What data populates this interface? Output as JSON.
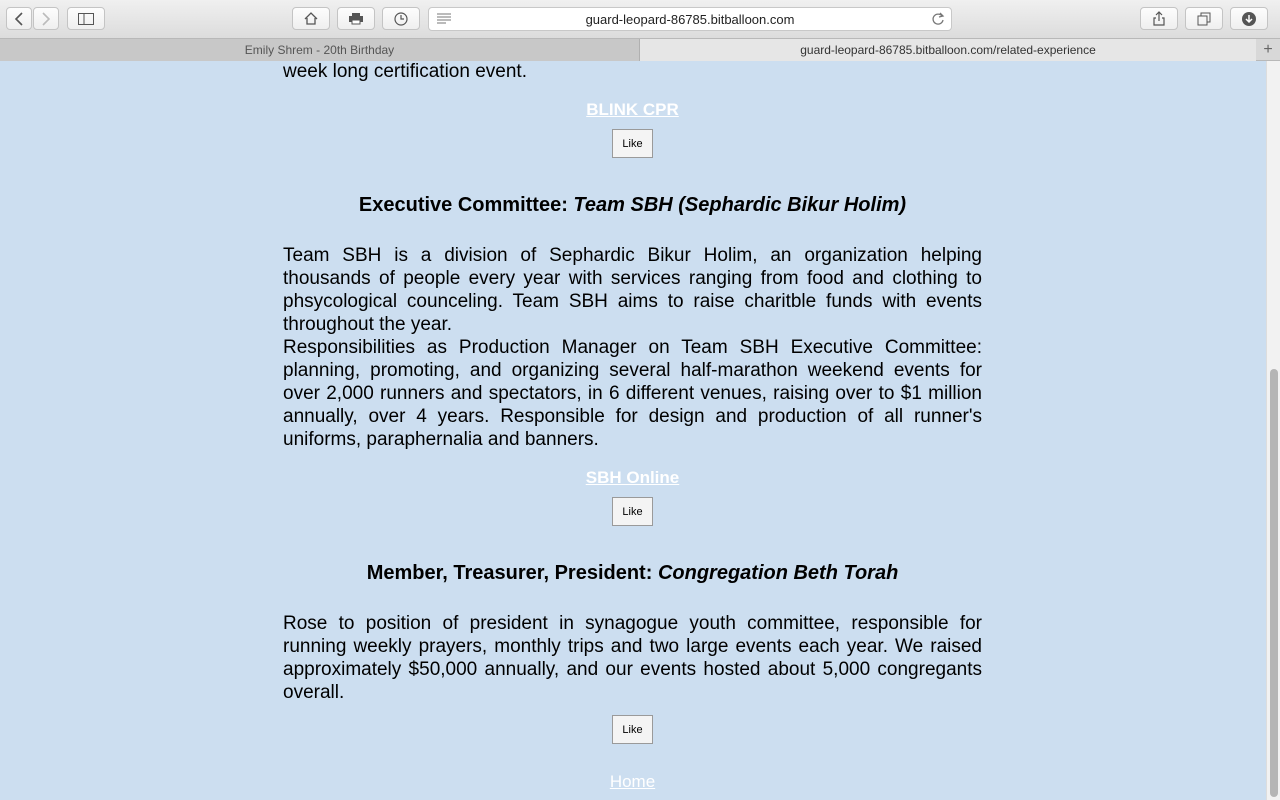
{
  "browser": {
    "url": "guard-leopard-86785.bitballoon.com",
    "tabs": [
      {
        "label": "Emily Shrem - 20th Birthday"
      },
      {
        "label": "guard-leopard-86785.bitballoon.com/related-experience"
      }
    ],
    "icons": [
      "back-icon",
      "forward-icon",
      "sidebar-icon",
      "home-icon",
      "print-icon",
      "history-icon",
      "reader-icon",
      "reload-icon",
      "share-icon",
      "tabs-overview-icon",
      "downloads-icon",
      "new-tab-icon"
    ]
  },
  "page": {
    "top_text": "week long certification event.",
    "sections": [
      {
        "link": "BLINK CPR",
        "like": "Like"
      },
      {
        "role": "Executive Committee: ",
        "org": "Team SBH (Sephardic Bikur Holim)",
        "p1": "Team SBH is a division of Sephardic Bikur Holim, an organization helping thousands of people every year with services ranging from food and clothing to phsycological counceling. Team SBH aims to raise charitble funds with events throughout the year.",
        "p2": "Responsibilities as Production Manager on Team SBH Executive Committee: planning, promoting, and organizing several half-marathon weekend events for over 2,000 runners and spectators, in 6 different venues, raising over to $1 million annually, over 4 years. Responsible for design and production of all runner's uniforms, paraphernalia and banners.",
        "link": "SBH Online",
        "like": "Like"
      },
      {
        "role": "Member, Treasurer, President: ",
        "org": "Congregation Beth Torah",
        "p1": "Rose to position of president in synagogue youth committee, responsible for running weekly prayers, monthly trips and two large events each year. We raised approximately $50,000 annually, and our events hosted about 5,000 congregants overall.",
        "like": "Like"
      }
    ],
    "home_link": "Home"
  },
  "colors": {
    "page_bg": "#ccdef0",
    "link": "#ffffff"
  }
}
